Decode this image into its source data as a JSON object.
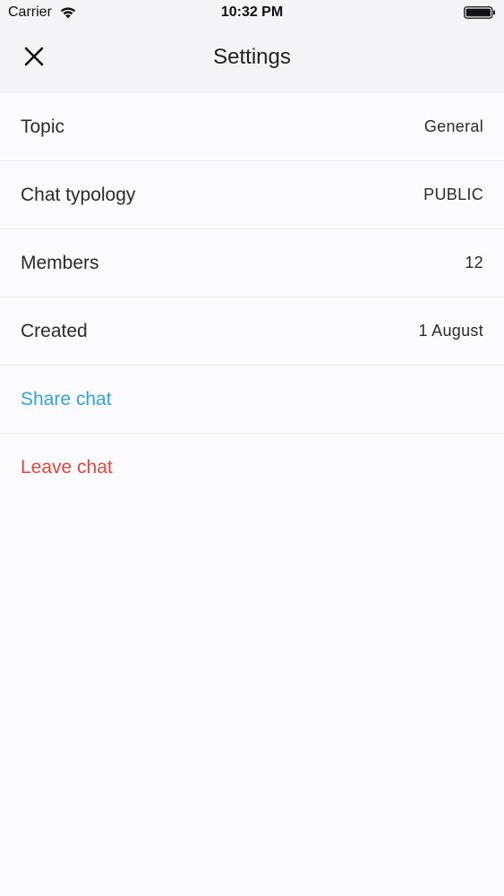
{
  "status_bar": {
    "carrier": "Carrier",
    "time": "10:32 PM"
  },
  "header": {
    "title": "Settings",
    "close_icon": "close-icon"
  },
  "rows": [
    {
      "label": "Topic",
      "value": "General"
    },
    {
      "label": "Chat typology",
      "value": "PUBLIC"
    },
    {
      "label": "Members",
      "value": "12"
    },
    {
      "label": "Created",
      "value": "1 August"
    }
  ],
  "actions": {
    "share_label": "Share chat",
    "leave_label": "Leave chat"
  },
  "colors": {
    "share": "#2fa6d8",
    "leave": "#e1483e",
    "header_bg": "#f4f4f6",
    "page_bg": "#fbfafc"
  }
}
